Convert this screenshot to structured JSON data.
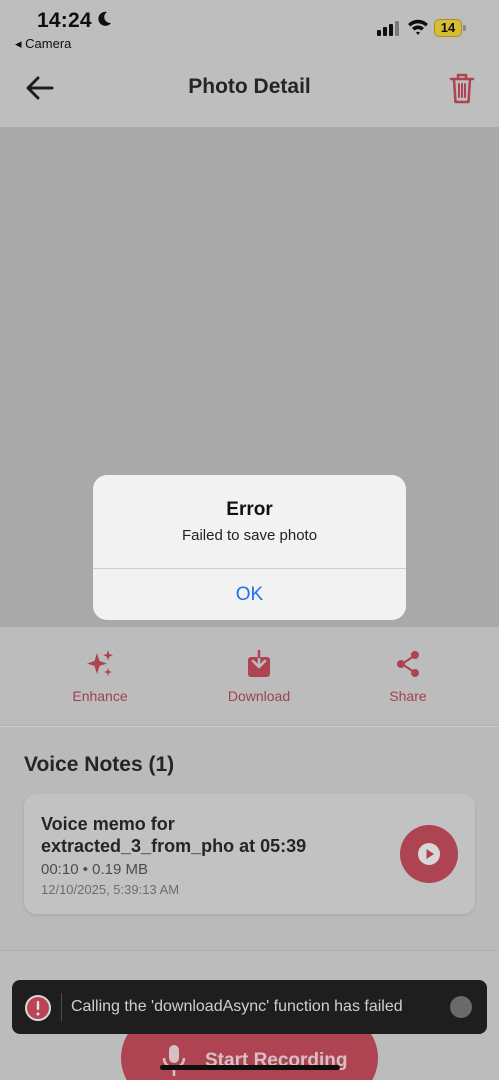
{
  "status_bar": {
    "time": "14:24",
    "back_app": "◂ Camera",
    "battery": "14"
  },
  "header": {
    "title": "Photo Detail"
  },
  "actions": {
    "enhance": "Enhance",
    "download": "Download",
    "share": "Share"
  },
  "voice_notes": {
    "title": "Voice Notes (1)",
    "items": [
      {
        "title": "Voice memo for extracted_3_from_pho at 05:39",
        "meta": "00:10 • 0.19 MB",
        "date": "12/10/2025, 5:39:13 AM"
      }
    ]
  },
  "record_button": {
    "label": "Start Recording"
  },
  "toast": {
    "message": "Calling the 'downloadAsync' function has failed"
  },
  "dialog": {
    "title": "Error",
    "message": "Failed to save photo",
    "ok": "OK"
  },
  "colors": {
    "accent": "#c24b5c",
    "link": "#1a73e8"
  }
}
